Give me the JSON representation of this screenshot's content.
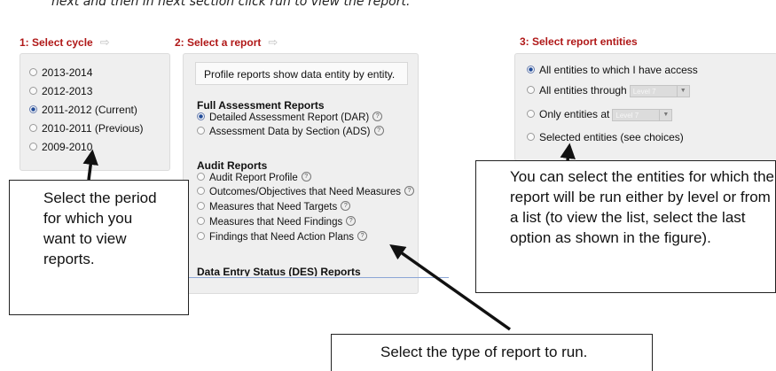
{
  "top_text": "next and then in next section click run to view the report.",
  "steps": {
    "cycle": {
      "header": "1: Select cycle",
      "icon": "right-arrow-icon",
      "glyph": "⇨"
    },
    "report": {
      "header": "2: Select a report",
      "icon": "right-arrow-icon",
      "glyph": "⇨"
    },
    "entities": {
      "header": "3: Select report entities"
    }
  },
  "cycles": [
    {
      "label": "2013-2014",
      "checked": false
    },
    {
      "label": "2012-2013",
      "checked": false
    },
    {
      "label": "2011-2012 (Current)",
      "checked": true
    },
    {
      "label": "2010-2011 (Previous)",
      "checked": false
    },
    {
      "label": "2009-2010",
      "checked": false
    }
  ],
  "report": {
    "info": "Profile reports show data entity by entity.",
    "full_assessment": {
      "title": "Full Assessment Reports",
      "items": [
        {
          "label": "Detailed Assessment Report (DAR)",
          "checked": true
        },
        {
          "label": "Assessment Data by Section (ADS)",
          "checked": false
        }
      ]
    },
    "audit": {
      "title": "Audit Reports",
      "items": [
        {
          "label": "Audit Report Profile",
          "checked": false
        },
        {
          "label": "Outcomes/Objectives that Need Measures",
          "checked": false
        },
        {
          "label": "Measures that Need Targets",
          "checked": false
        },
        {
          "label": "Measures that Need Findings",
          "checked": false
        },
        {
          "label": "Findings that Need Action Plans",
          "checked": false
        }
      ]
    },
    "des_title": "Data Entry Status (DES) Reports"
  },
  "entities": {
    "options": [
      {
        "label": "All entities to which I have access",
        "checked": true
      },
      {
        "label": "All entities through",
        "checked": false,
        "select": "Level 7"
      },
      {
        "label": "Only entities at",
        "checked": false,
        "select": "Level 7"
      },
      {
        "label": "Selected entities (see choices)",
        "checked": false
      }
    ]
  },
  "help_glyph": "?",
  "caret_glyph": "▼",
  "callouts": {
    "period": "Select the period for which you want to view reports.",
    "entities": "You can select the entities for which the report will be run either by level or from a list (to view the list, select the last option as shown in the figure).",
    "report_type": "Select the type of report to run."
  },
  "colors": {
    "step_header": "#b01818",
    "panel": "#efefef",
    "callout_border": "#222222"
  }
}
